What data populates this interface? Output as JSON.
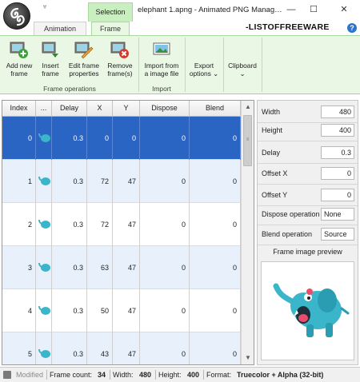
{
  "window": {
    "title": "elephant 1.apng - Animated PNG Manag…",
    "minimize": "—",
    "maximize": "☐",
    "close": "✕"
  },
  "context_tab": "Selection",
  "qat": "▿",
  "tabs": [
    "Animation",
    "Frame"
  ],
  "watermark": "-LISTOFFREEWARE",
  "help": "?",
  "ribbon": {
    "frame_operations": {
      "label": "Frame operations",
      "buttons": [
        {
          "line1": "Add new",
          "line2": "frame"
        },
        {
          "line1": "Insert",
          "line2": "frame"
        },
        {
          "line1": "Edit frame",
          "line2": "properties"
        },
        {
          "line1": "Remove",
          "line2": "frame(s)"
        }
      ]
    },
    "import": {
      "label": "Import",
      "button": {
        "line1": "Import from",
        "line2": "a image file"
      }
    },
    "export": {
      "line1": "Export",
      "line2": "options ⌄"
    },
    "clipboard": {
      "line1": "Clipboard",
      "line2": "⌄"
    }
  },
  "table": {
    "columns": [
      "Index",
      "...",
      "Delay",
      "X",
      "Y",
      "Dispose",
      "Blend"
    ],
    "rows": [
      {
        "index": "0",
        "delay": "0.3",
        "x": "0",
        "y": "0",
        "dispose": "0",
        "blend": "0"
      },
      {
        "index": "1",
        "delay": "0.3",
        "x": "72",
        "y": "47",
        "dispose": "0",
        "blend": "0"
      },
      {
        "index": "2",
        "delay": "0.3",
        "x": "72",
        "y": "47",
        "dispose": "0",
        "blend": "0"
      },
      {
        "index": "3",
        "delay": "0.3",
        "x": "63",
        "y": "47",
        "dispose": "0",
        "blend": "0"
      },
      {
        "index": "4",
        "delay": "0.3",
        "x": "50",
        "y": "47",
        "dispose": "0",
        "blend": "0"
      },
      {
        "index": "5",
        "delay": "0.3",
        "x": "43",
        "y": "47",
        "dispose": "0",
        "blend": "0"
      }
    ],
    "selected_row": 0
  },
  "scrollbar": {
    "up": "▲",
    "down": "▼",
    "thumb": "≡"
  },
  "properties": {
    "width": {
      "label": "Width",
      "value": "480"
    },
    "height": {
      "label": "Height",
      "value": "400"
    },
    "delay": {
      "label": "Delay",
      "value": "0.3"
    },
    "offset_x": {
      "label": "Offset X",
      "value": "0"
    },
    "offset_y": {
      "label": "Offset Y",
      "value": "0"
    },
    "dispose": {
      "label": "Dispose operation",
      "value": "None"
    },
    "blend": {
      "label": "Blend operation",
      "value": "Source"
    },
    "preview_title": "Frame image preview"
  },
  "status": {
    "modified": "Modified",
    "frame_count_label": "Frame count:",
    "frame_count": "34",
    "width_label": "Width:",
    "width": "480",
    "height_label": "Height:",
    "height": "400",
    "format_label": "Format:",
    "format": "Truecolor + Alpha (32-bit)"
  },
  "colors": {
    "selection": "#2a65c4",
    "ribbon_bg": "#e9f7e4",
    "elephant": "#3ab5c9"
  }
}
